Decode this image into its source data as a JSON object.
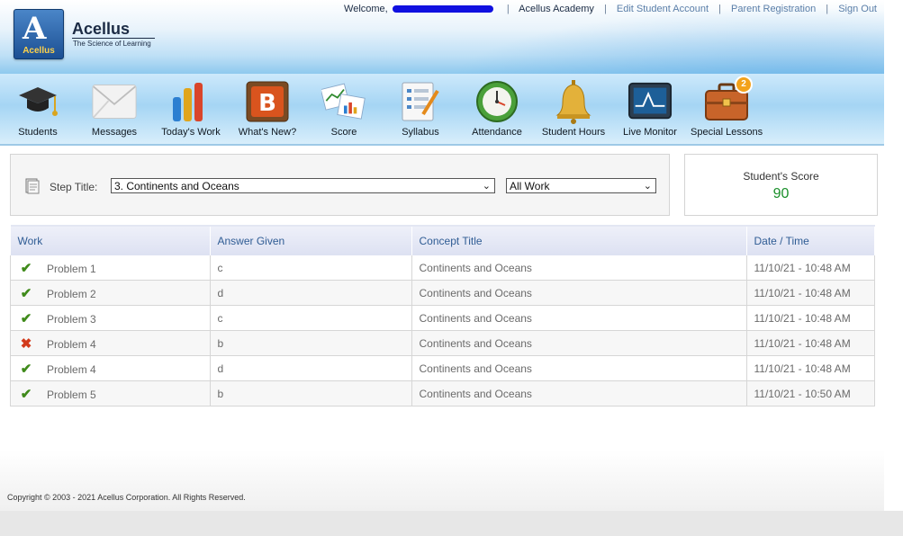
{
  "brand": {
    "logo_word": "Acellus",
    "name": "Acellus",
    "tagline": "The Science of Learning"
  },
  "top_links": {
    "welcome": "Welcome,",
    "academy": "Acellus Academy",
    "edit_account": "Edit Student Account",
    "parent_registration": "Parent Registration",
    "sign_out": "Sign Out",
    "separator": "|"
  },
  "toolbar": [
    {
      "label": "Students",
      "icon": "graduation-cap-icon"
    },
    {
      "label": "Messages",
      "icon": "envelope-icon"
    },
    {
      "label": "Today's Work",
      "icon": "bar-chart-icon"
    },
    {
      "label": "What's New?",
      "icon": "blogger-icon"
    },
    {
      "label": "Score",
      "icon": "score-charts-icon"
    },
    {
      "label": "Syllabus",
      "icon": "syllabus-list-icon"
    },
    {
      "label": "Attendance",
      "icon": "clock-icon"
    },
    {
      "label": "Student Hours",
      "icon": "bell-icon"
    },
    {
      "label": "Live Monitor",
      "icon": "monitor-icon"
    },
    {
      "label": "Special Lessons",
      "icon": "briefcase-icon",
      "badge": "2"
    }
  ],
  "step": {
    "label": "Step Title:",
    "selected": "3. Continents and Oceans",
    "filter_selected": "All Work"
  },
  "score": {
    "title": "Student's Score",
    "value": "90"
  },
  "table": {
    "headers": [
      "Work",
      "Answer Given",
      "Concept Title",
      "Date / Time"
    ],
    "rows": [
      {
        "status": "correct",
        "work": "Problem 1",
        "answer": "c",
        "concept": "Continents and Oceans",
        "datetime": "11/10/21 - 10:48 AM"
      },
      {
        "status": "correct",
        "work": "Problem 2",
        "answer": "d",
        "concept": "Continents and Oceans",
        "datetime": "11/10/21 - 10:48 AM"
      },
      {
        "status": "correct",
        "work": "Problem 3",
        "answer": "c",
        "concept": "Continents and Oceans",
        "datetime": "11/10/21 - 10:48 AM"
      },
      {
        "status": "incorrect",
        "work": "Problem 4",
        "answer": "b",
        "concept": "Continents and Oceans",
        "datetime": "11/10/21 - 10:48 AM"
      },
      {
        "status": "correct",
        "work": "Problem 4",
        "answer": "d",
        "concept": "Continents and Oceans",
        "datetime": "11/10/21 - 10:48 AM"
      },
      {
        "status": "correct",
        "work": "Problem 5",
        "answer": "b",
        "concept": "Continents and Oceans",
        "datetime": "11/10/21 - 10:50 AM"
      }
    ]
  },
  "footer": "Copyright © 2003 - 2021 Acellus Corporation.  All Rights Reserved.",
  "colors": {
    "correct": "#3f8a1a",
    "incorrect": "#d23a1b",
    "score": "#1a8f2a",
    "header_text": "#2f5c94"
  }
}
